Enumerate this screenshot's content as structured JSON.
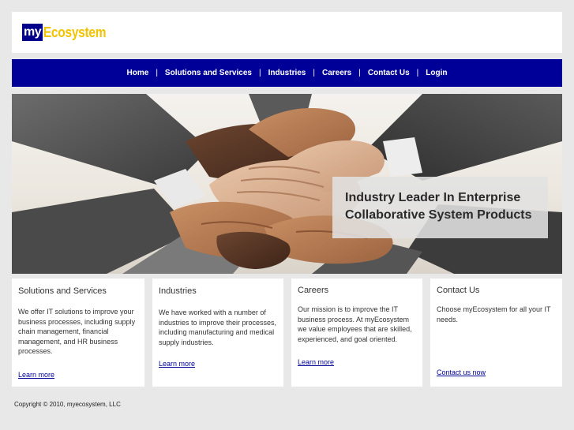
{
  "logo": {
    "part1": "my",
    "part2": "Ecosystem"
  },
  "nav": {
    "items": [
      "Home",
      "Solutions and Services",
      "Industries",
      "Careers",
      "Contact Us",
      "Login"
    ],
    "separator": "|"
  },
  "hero": {
    "line1": "Industry Leader In Enterprise",
    "line2": "Collaborative System Products"
  },
  "cards": [
    {
      "title": "Solutions and Services",
      "body": "We offer IT solutions to improve your business processes, including supply chain management, financial management, and HR business processes.",
      "link": "Learn more"
    },
    {
      "title": "Industries",
      "body": "We have worked with a number of industries to improve their processes, including manufacturing and medical supply industries.",
      "link": "Learn more"
    },
    {
      "title": "Careers",
      "body": "Our mission is to improve the IT business process. At myEcosystem we value employees that are skilled, experienced, and goal oriented.",
      "link": "Learn more"
    },
    {
      "title": "Contact Us",
      "body": "Choose myEcosystem for all your IT needs.",
      "link": "Contact us now"
    }
  ],
  "footer": {
    "copyright": "Copyright © 2010, myecosystem, LLC"
  },
  "colors": {
    "nav_bg": "#000099",
    "logo_blue": "#00008b",
    "logo_yellow": "#f2c300",
    "link": "#000099"
  }
}
